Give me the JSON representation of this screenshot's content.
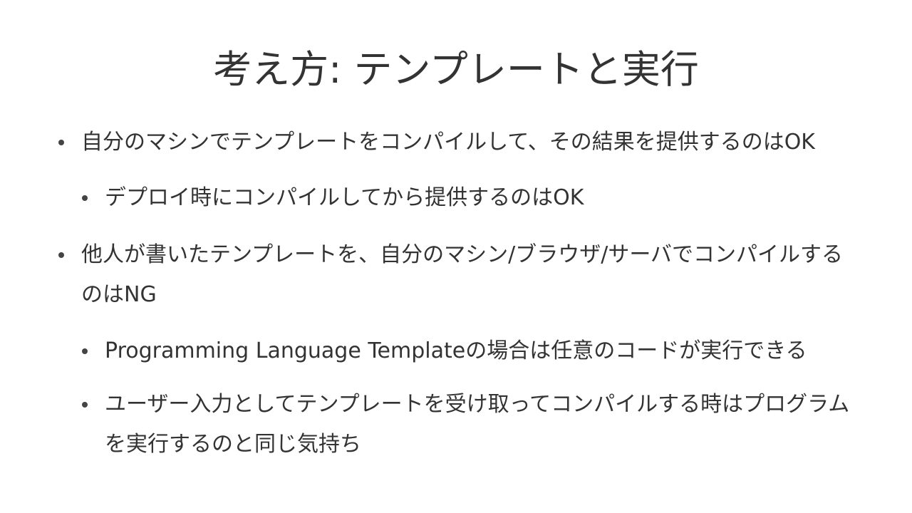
{
  "slide": {
    "title": "考え方: テンプレートと実行",
    "bullets": [
      {
        "text": "自分のマシンでテンプレートをコンパイルして、その結果を提供するのはOK",
        "children": [
          {
            "text": "デプロイ時にコンパイルしてから提供するのはOK"
          }
        ]
      },
      {
        "text": "他人が書いたテンプレートを、自分のマシン/ブラウザ/サーバでコンパイルするのはNG",
        "children": [
          {
            "text": "Programming Language Templateの場合は任意のコードが実行できる"
          },
          {
            "text": "ユーザー入力としてテンプレートを受け取ってコンパイルする時はプログラムを実行するのと同じ気持ち"
          }
        ]
      }
    ]
  }
}
